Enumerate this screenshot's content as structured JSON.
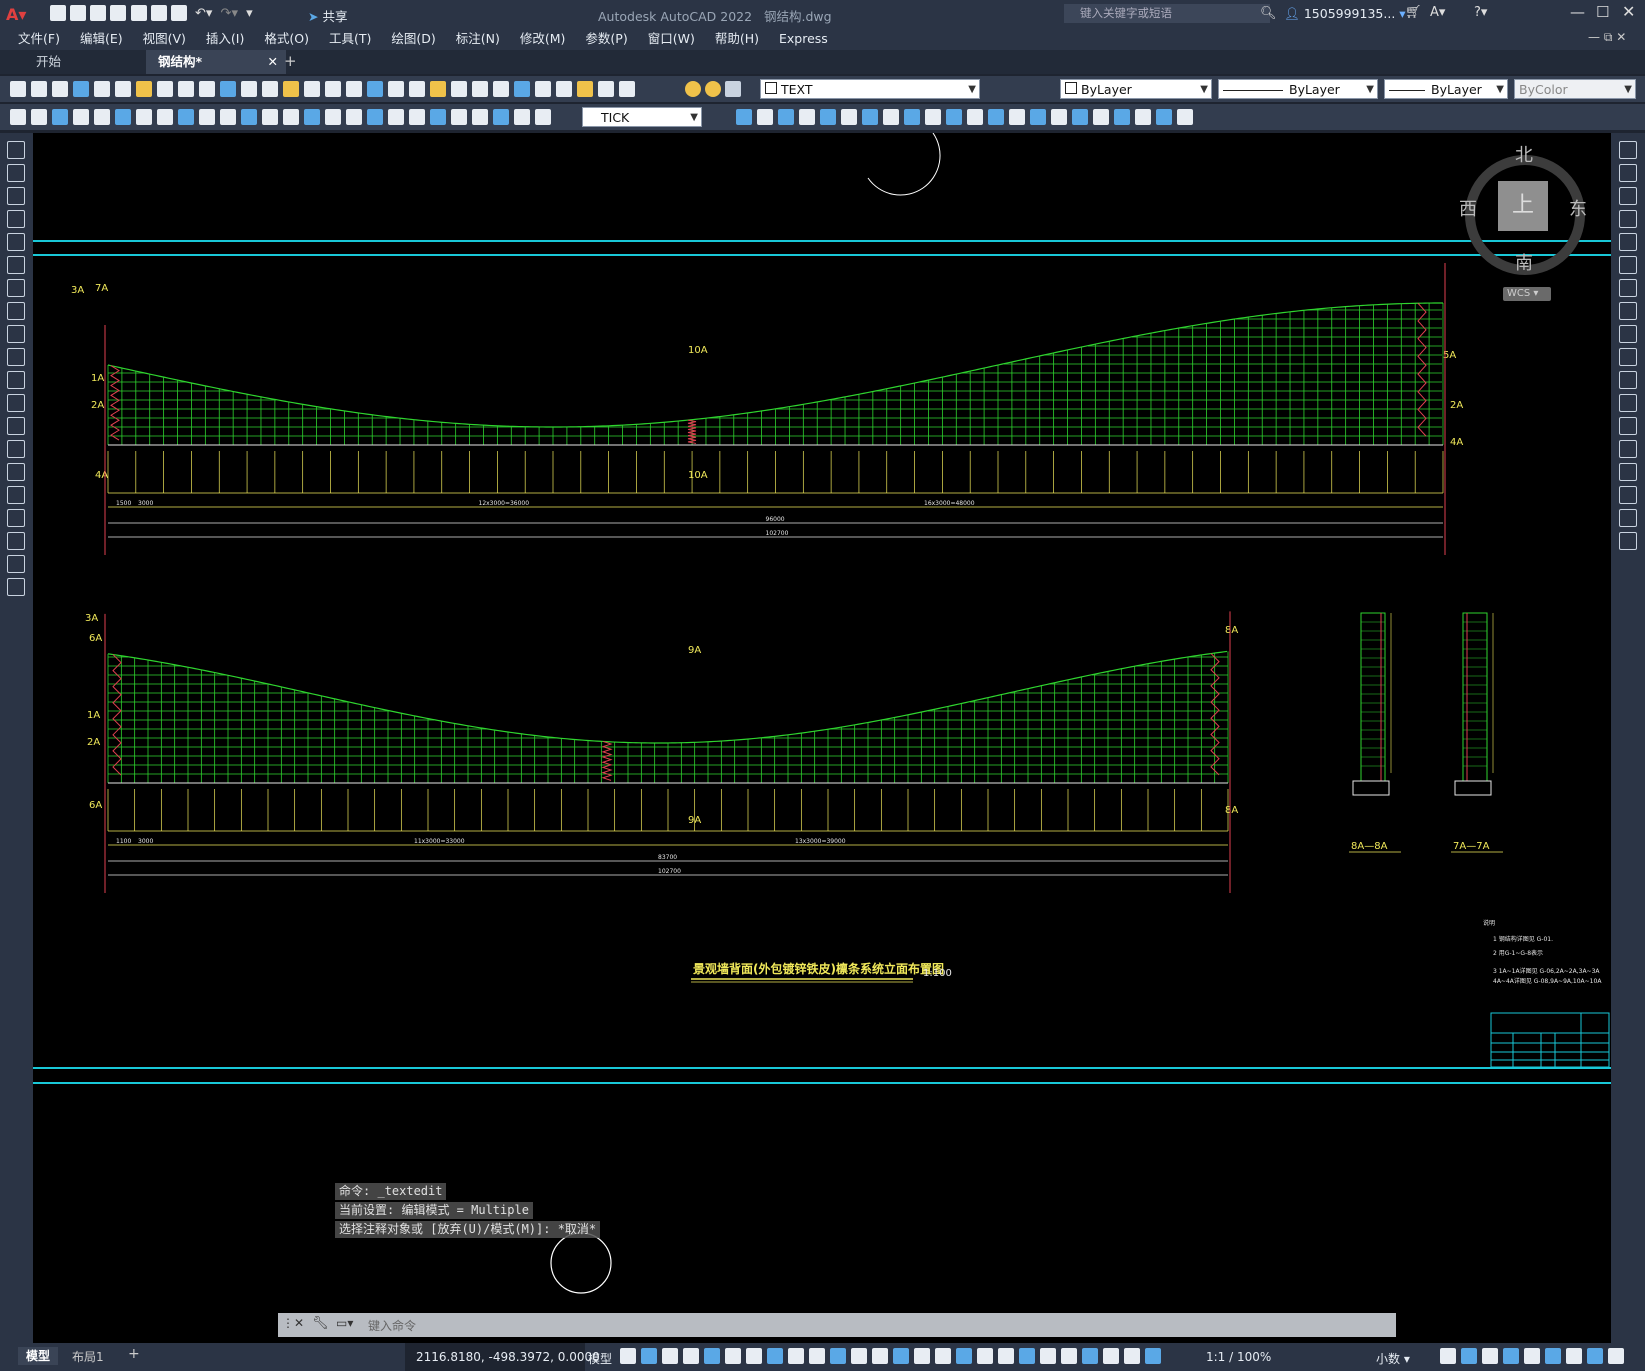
{
  "app": {
    "title": "Autodesk AutoCAD 2022",
    "filename": "钢结构.dwg",
    "share": "共享",
    "search_placeholder": "键入关键字或短语",
    "user": "1505999135..."
  },
  "menu": [
    "文件(F)",
    "编辑(E)",
    "视图(V)",
    "插入(I)",
    "格式(O)",
    "工具(T)",
    "绘图(D)",
    "标注(N)",
    "修改(M)",
    "参数(P)",
    "窗口(W)",
    "帮助(H)",
    "Express"
  ],
  "tabs": [
    {
      "label": "开始"
    },
    {
      "label": "钢结构*"
    }
  ],
  "toolbar": {
    "layer": "TEXT",
    "color": "ByLayer",
    "linetype": "ByLayer",
    "lineweight": "ByLayer",
    "plotstyle": "ByColor",
    "dimstyle": "TICK"
  },
  "viewcube": {
    "north": "北",
    "south": "南",
    "east": "东",
    "west": "西",
    "top": "上",
    "wcs": "WCS"
  },
  "drawing": {
    "title": "景观墙背面(外包镀锌铁皮)檩条系统立面布置图",
    "scale": "1:100",
    "section_a": "A",
    "marks_top": [
      "3A",
      "7A",
      "1A",
      "2A",
      "4A",
      "10A",
      "5A"
    ],
    "marks_bottom": [
      "3A",
      "6A",
      "1A",
      "2A",
      "9A",
      "8A"
    ],
    "dims_top": [
      "1500",
      "3000",
      "12x3000=36000",
      "16x3000=48000",
      "96000",
      "102700"
    ],
    "dims_bottom": [
      "1100",
      "3000",
      "11x3000=33000",
      "13x3000=39000",
      "83700",
      "102700"
    ],
    "sections": [
      "8A—8A",
      "7A—7A"
    ],
    "notes_title": "说明",
    "notes": [
      "1 钢结构详图见 G-01.",
      "2 用G-1~G-8表示",
      "3 1A~1A详图见 G-06,2A~2A,3A~3A",
      "4A~4A详图见 G-08,9A~9A,10A~10A"
    ]
  },
  "command": {
    "lines": [
      "命令: _textedit",
      "当前设置: 编辑模式 = Multiple",
      "选择注释对象或 [放弃(U)/模式(M)]: *取消*"
    ],
    "placeholder": "键入命令"
  },
  "status": {
    "model_tab": "模型",
    "layout_tab": "布局1",
    "coords": "2116.8180, -498.3972, 0.0000",
    "mode": "模型",
    "scale": "1:1 / 100%",
    "units": "小数"
  }
}
